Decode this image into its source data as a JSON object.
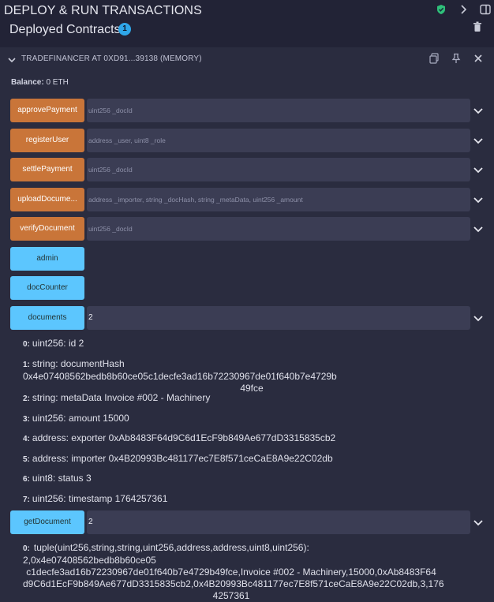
{
  "header": {
    "title": "DEPLOY & RUN TRANSACTIONS",
    "subtitle": "Deployed Contracts",
    "deployed_count": "1"
  },
  "contract": {
    "name": "TRADEFINANCER AT 0XD91...39138 (MEMORY)",
    "balance_label": "Balance:",
    "balance_value": "0 ETH"
  },
  "functions": [
    {
      "label": "approvePayment",
      "placeholder": "uint256 _docId",
      "kind": "transact"
    },
    {
      "label": "registerUser",
      "placeholder": "address _user, uint8 _role",
      "kind": "transact"
    },
    {
      "label": "settlePayment",
      "placeholder": "uint256 _docId",
      "kind": "transact"
    },
    {
      "label": "uploadDocume...",
      "placeholder": "address _importer, string _docHash, string _metaData, uint256 _amount",
      "kind": "transact"
    },
    {
      "label": "verifyDocument",
      "placeholder": "uint256 _docId",
      "kind": "transact"
    },
    {
      "label": "admin",
      "kind": "call"
    },
    {
      "label": "docCounter",
      "kind": "call"
    },
    {
      "label": "documents",
      "value": "2",
      "kind": "call"
    },
    {
      "label": "getDocument",
      "value": "2",
      "kind": "call"
    }
  ],
  "documents_output": [
    {
      "idx": "0:",
      "text": "uint256: id 2"
    },
    {
      "idx": "1:",
      "text": "string: documentHash 0x4e07408562bedb8b60ce05c1decfe3ad16b72230967de01f640b7e4729b",
      "cont": "49fce"
    },
    {
      "idx": "2:",
      "text": "string: metaData Invoice #002 - Machinery"
    },
    {
      "idx": "3:",
      "text": "uint256: amount 15000"
    },
    {
      "idx": "4:",
      "text": "address: exporter 0xAb8483F64d9C6d1EcF9b849Ae677dD3315835cb2"
    },
    {
      "idx": "5:",
      "text": "address: importer 0x4B20993Bc481177ec7E8f571ceCaE8A9e22C02db"
    },
    {
      "idx": "6:",
      "text": "uint8: status 3"
    },
    {
      "idx": "7:",
      "text": "uint256: timestamp 1764257361"
    }
  ],
  "getdocument_output": {
    "idx": "0:",
    "lines": [
      "tuple(uint256,string,string,uint256,address,address,uint8,uint256): 2,0x4e07408562bedb8b60ce05",
      "c1decfe3ad16b72230967de01f640b7e4729b49fce,Invoice #002 - Machinery,15000,0xAb8483F64",
      "d9C6d1EcF9b849Ae677dD3315835cb2,0x4B20993Bc481177ec7E8f571ceCaE8A9e22C02db,3,176",
      "4257361"
    ]
  },
  "colors": {
    "transact": "#c97539",
    "call": "#5cc6fe",
    "background": "#222336",
    "panel": "#2a2c3f"
  }
}
